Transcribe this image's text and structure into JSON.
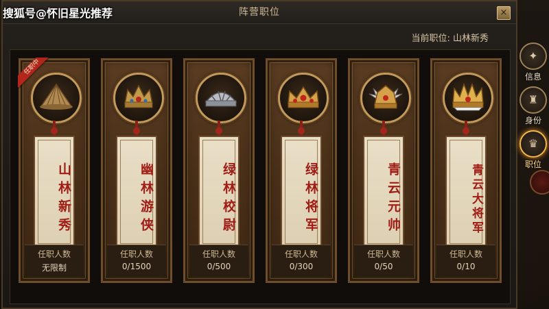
{
  "watermark": "搜狐号@怀旧星光推荐",
  "window": {
    "title": "阵营职位",
    "close_icon": "×"
  },
  "status": {
    "current_position_text": "当前职位: 山林新秀"
  },
  "ranks": [
    {
      "name": "山林新秀",
      "count_label": "任职人数",
      "count_value": "无限制",
      "badge": "任职中",
      "icon": "straw-hat-icon"
    },
    {
      "name": "幽林游侠",
      "count_label": "任职人数",
      "count_value": "0/1500",
      "icon": "bronze-crown-icon"
    },
    {
      "name": "绿林校尉",
      "count_label": "任职人数",
      "count_value": "0/500",
      "icon": "silver-helmet-icon"
    },
    {
      "name": "绿林将军",
      "count_label": "任职人数",
      "count_value": "0/300",
      "icon": "jeweled-crown-icon"
    },
    {
      "name": "青云元帅",
      "count_label": "任职人数",
      "count_value": "0/50",
      "icon": "winged-crown-icon"
    },
    {
      "name": "青云大将军",
      "count_label": "任职人数",
      "count_value": "0/10",
      "icon": "grand-crown-icon"
    }
  ],
  "side_tabs": [
    {
      "label": "信息",
      "icon": "info-icon",
      "glyph": "✦"
    },
    {
      "label": "身份",
      "icon": "identity-icon",
      "glyph": "♜"
    },
    {
      "label": "职位",
      "icon": "rank-icon",
      "glyph": "♛",
      "active": true
    }
  ],
  "colors": {
    "accent_gold": "#c29a5c",
    "title_red": "#a01d16",
    "badge_red": "#b3261c"
  }
}
